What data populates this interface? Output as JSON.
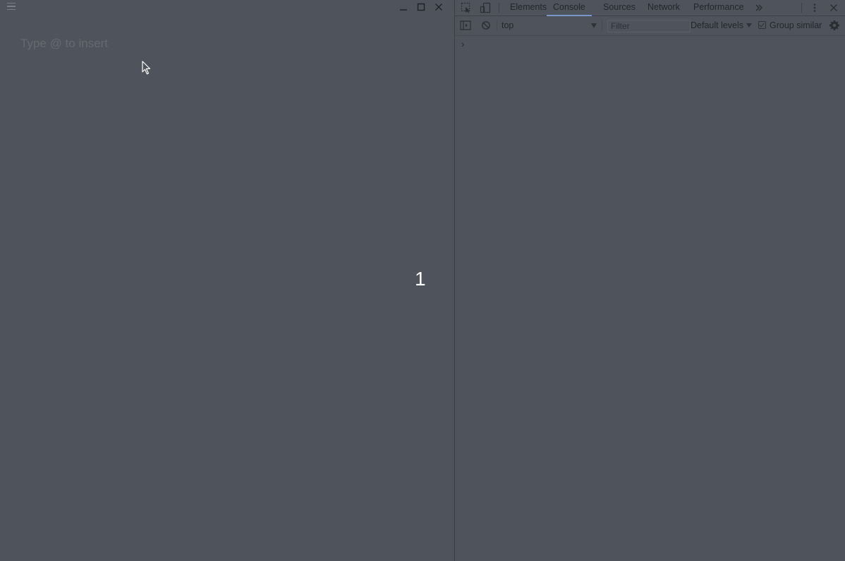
{
  "app": {
    "editor": {
      "placeholder": "Type @ to insert"
    },
    "page_number": "1"
  },
  "icons": {
    "menu": "hamburger-icon",
    "minimize": "minimize-icon",
    "maximize": "maximize-icon",
    "close": "close-icon",
    "inspect": "inspect-element-icon",
    "device": "device-toolbar-icon",
    "more_tabs": "chevron-double-right-icon",
    "kebab": "kebab-menu-icon",
    "sidebar": "console-sidebar-icon",
    "clear": "clear-console-icon",
    "settings": "gear-icon",
    "cursor": "mouse-pointer-icon"
  },
  "devtools": {
    "tabs": [
      {
        "label": "Elements",
        "active": false
      },
      {
        "label": "Console",
        "active": true
      },
      {
        "label": "Sources",
        "active": false
      },
      {
        "label": "Network",
        "active": false
      },
      {
        "label": "Performance",
        "active": false
      }
    ],
    "toolbar": {
      "context": "top",
      "filter_placeholder": "Filter",
      "levels": "Default levels",
      "group_similar": "Group similar",
      "group_similar_checked": true
    },
    "console": {
      "prompt": "›"
    }
  },
  "colors": {
    "background": "#4f535c",
    "active_tab_underline": "#7797c8",
    "page_number_text": "#ffffff"
  }
}
